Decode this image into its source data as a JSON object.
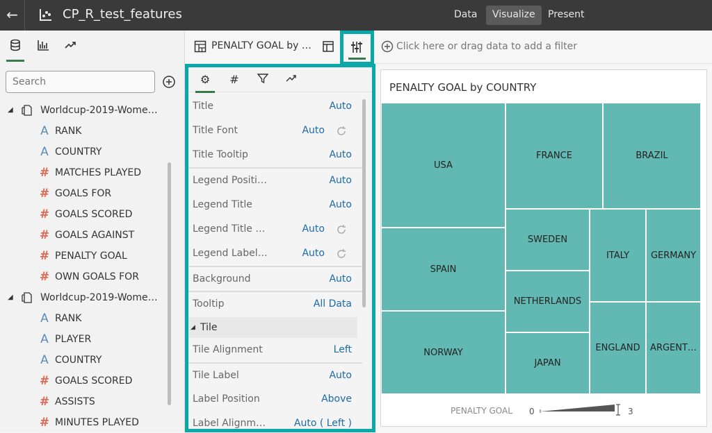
{
  "header": {
    "back_icon": "back-arrow-icon",
    "app_icon": "project-icon",
    "title": "CP_R_test_features",
    "modes": [
      "Data",
      "Visualize",
      "Present"
    ],
    "active_mode": "Visualize"
  },
  "left_panel": {
    "tabs": [
      "data-icon",
      "visualizations-icon",
      "analytics-icon"
    ],
    "search_placeholder": "Search",
    "datasets": [
      {
        "name": "Worldcup-2019-Wome…",
        "columns": [
          {
            "type": "attribute",
            "glyph": "A",
            "label": "RANK"
          },
          {
            "type": "attribute",
            "glyph": "A",
            "label": "COUNTRY"
          },
          {
            "type": "measure",
            "glyph": "#",
            "label": "MATCHES PLAYED"
          },
          {
            "type": "measure",
            "glyph": "#",
            "label": "GOALS FOR"
          },
          {
            "type": "measure",
            "glyph": "#",
            "label": "GOALS SCORED"
          },
          {
            "type": "measure",
            "glyph": "#",
            "label": "GOALS AGAINST"
          },
          {
            "type": "measure",
            "glyph": "#",
            "label": "PENALTY GOAL"
          },
          {
            "type": "measure",
            "glyph": "#",
            "label": "OWN GOALS FOR"
          }
        ]
      },
      {
        "name": "Worldcup-2019-Wome…",
        "columns": [
          {
            "type": "attribute",
            "glyph": "A",
            "label": "RANK"
          },
          {
            "type": "attribute",
            "glyph": "A",
            "label": "PLAYER"
          },
          {
            "type": "attribute",
            "glyph": "A",
            "label": "COUNTRY"
          },
          {
            "type": "measure",
            "glyph": "#",
            "label": "GOALS SCORED"
          },
          {
            "type": "measure",
            "glyph": "#",
            "label": "ASSISTS"
          },
          {
            "type": "measure",
            "glyph": "#",
            "label": "MINUTES PLAYED"
          }
        ]
      }
    ]
  },
  "properties": {
    "viz_title": "PENALTY GOAL by …",
    "tabs": [
      "gear-icon",
      "hash-icon",
      "filter-icon",
      "analytics-icon"
    ],
    "rows": [
      {
        "label": "Title",
        "value": "Auto"
      },
      {
        "label": "Title Font",
        "value": "Auto",
        "reset": true
      },
      {
        "label": "Title Tooltip",
        "value": "Auto"
      },
      {
        "label": "Legend Positi…",
        "value": "Auto"
      },
      {
        "label": "Legend Title",
        "value": "Auto"
      },
      {
        "label": "Legend Title F…",
        "value": "Auto",
        "reset": true
      },
      {
        "label": "Legend Labels…",
        "value": "Auto",
        "reset": true
      },
      {
        "label": "Background",
        "value": "Auto"
      },
      {
        "label": "Tooltip",
        "value": "All Data"
      },
      {
        "label": "Tile Alignment",
        "value": "Left"
      },
      {
        "label": "Tile Label",
        "value": "Auto"
      },
      {
        "label": "Label Position",
        "value": "Above"
      },
      {
        "label": "Label Alignment",
        "value": "Auto ( Left )"
      }
    ],
    "section_tile": "Tile"
  },
  "filter_bar": {
    "placeholder": "Click here or drag data to add a filter"
  },
  "visualization": {
    "title": "PENALTY GOAL by COUNTRY",
    "tile_color": "#62b8b3",
    "tiles": [
      "USA",
      "FRANCE",
      "BRAZIL",
      "SPAIN",
      "SWEDEN",
      "ITALY",
      "GERMANY",
      "NETHERLANDS",
      "NORWAY",
      "ENGLAND",
      "ARGENT…",
      "JAPAN"
    ],
    "legend": {
      "title": "PENALTY GOAL",
      "min": "0",
      "max": "3"
    }
  },
  "colors": {
    "accent": "#0aa8a8",
    "header_bg": "#3a3a3a",
    "value_text": "#1c6aa6"
  }
}
